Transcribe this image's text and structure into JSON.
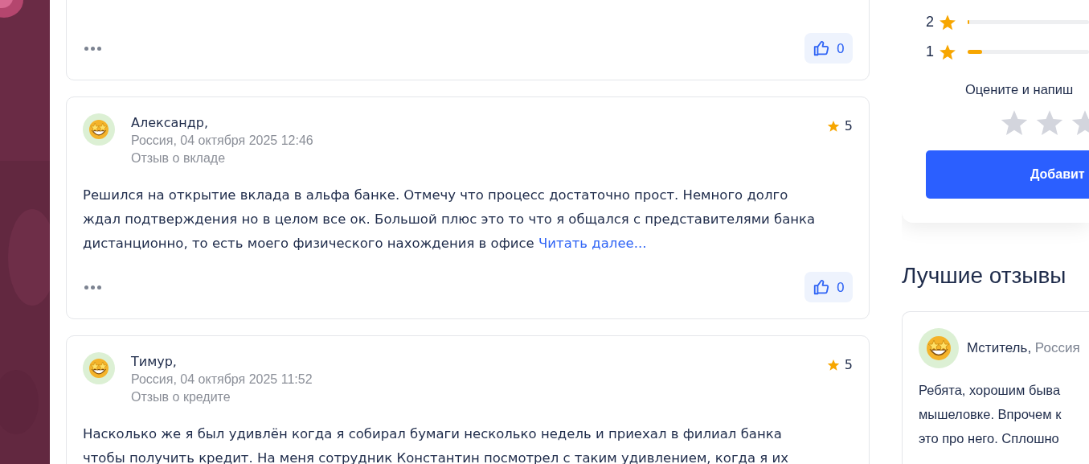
{
  "reviews": [
    {
      "kind": "partial",
      "likes": "0"
    },
    {
      "kind": "full",
      "author": "Александр,",
      "meta": "Россия, 04 октября 2025 12:46",
      "topic": "Отзыв о вкладе",
      "rating": "5",
      "text": "Решился на открытие вклада в альфа банке. Отмечу что процесс достаточно прост. Немного долго ждал подтверждения но в целом все ок. Большой плюс это то что я общался с представителями банка дистанционно, то есть моего физического нахождения в офисе",
      "more": "Читать далее...",
      "likes": "0"
    },
    {
      "kind": "full",
      "author": "Тимур,",
      "meta": "Россия, 04 октября 2025 11:52",
      "topic": "Отзыв о кредите",
      "rating": "5",
      "text": "Насколько же я был удивлён когда я собирал бумаги несколько недель и приехал в филиал банка чтобы получить кредит. На меня сотрудник Константин посмотрел с таким удивлением, когда я их"
    }
  ],
  "rating_summary": {
    "rows": [
      {
        "label": "2",
        "level": 0.01
      },
      {
        "label": "1",
        "level": 0.12
      }
    ],
    "prompt": "Оцените и напиш",
    "stars": 0,
    "button": "Добавит"
  },
  "best_reviews": {
    "title": "Лучшие отзывы",
    "items": [
      {
        "author": "Мститель,",
        "location": "Россия",
        "lines": [
          "Ребята, хорошим быва",
          "мышеловке. Впрочем к",
          "это про него. Сплошно"
        ]
      }
    ]
  }
}
